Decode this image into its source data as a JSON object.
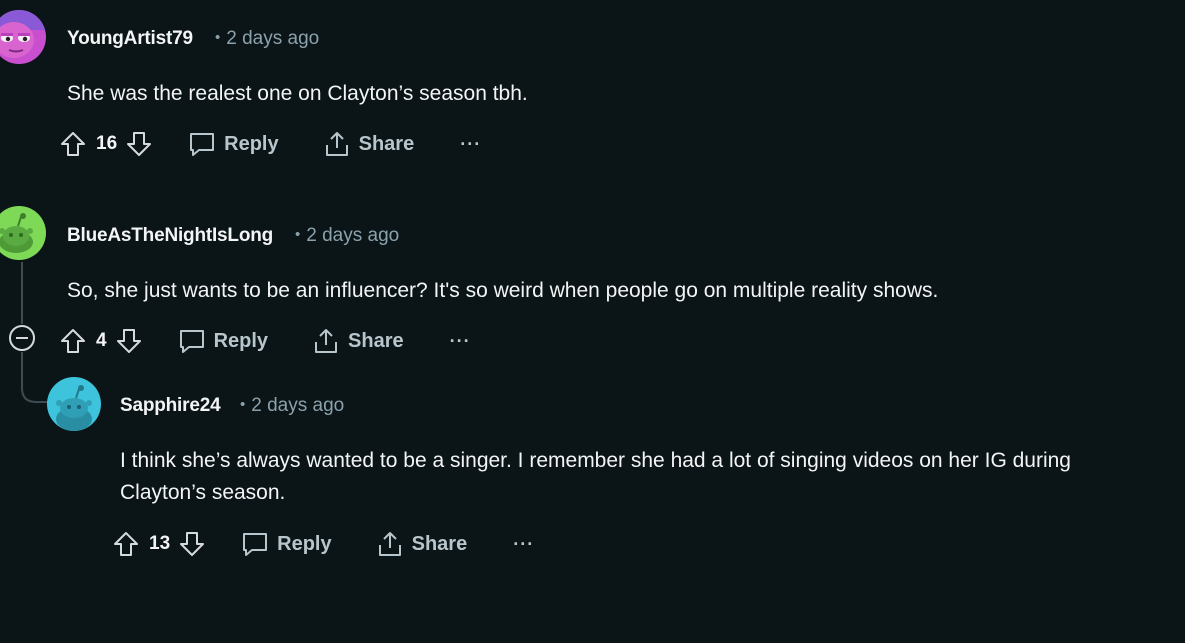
{
  "comments": [
    {
      "username": "YoungArtist79",
      "time": "2 days ago",
      "body": "She was the realest one on Clayton’s season tbh.",
      "votes": "16",
      "reply_label": "Reply",
      "share_label": "Share",
      "more_label": "···"
    },
    {
      "username": "BlueAsTheNightIsLong",
      "time": "2 days ago",
      "body": "So, she just wants to be an influencer? It's so weird when people go on multiple reality shows.",
      "votes": "4",
      "reply_label": "Reply",
      "share_label": "Share",
      "more_label": "···"
    },
    {
      "username": "Sapphire24",
      "time": "2 days ago",
      "body_line1": "I think she’s always wanted to be a singer. I remember she had a lot of singing videos on her IG during",
      "body_line2": "Clayton’s season.",
      "votes": "13",
      "reply_label": "Reply",
      "share_label": "Share",
      "more_label": "···"
    }
  ],
  "meta_separator": "•",
  "colors": {
    "background": "#0b1416",
    "text": "#f2f4f5",
    "meta": "#8ba2ad",
    "avatar_pink": "#d05bd6",
    "avatar_green": "#7ed957",
    "avatar_cyan": "#3ec3dd"
  },
  "icons": [
    "upvote-icon",
    "downvote-icon",
    "comment-icon",
    "share-icon",
    "more-icon",
    "collapse-icon"
  ]
}
